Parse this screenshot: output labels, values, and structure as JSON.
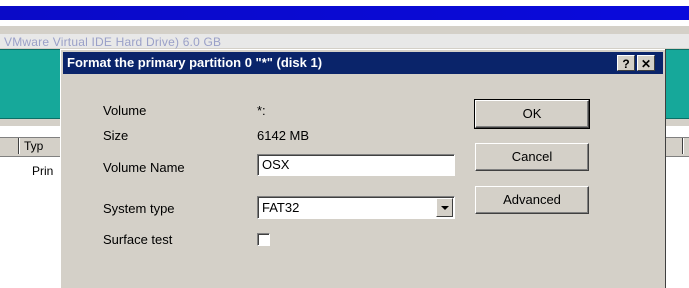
{
  "background": {
    "window_title": "VMware Virtual IDE Hard Drive) 6.0 GB",
    "column_header": "Typ",
    "row_text": "Prin"
  },
  "dialog": {
    "title": "Format the primary partition 0  \"*\" (disk 1)",
    "help_label": "?",
    "close_label": "✕",
    "fields": {
      "volume_label": "Volume",
      "volume_value": "*:",
      "size_label": "Size",
      "size_value": "6142 MB",
      "volume_name_label": "Volume Name",
      "volume_name_value": "OSX",
      "system_type_label": "System type",
      "system_type_value": "FAT32",
      "surface_test_label": "Surface test"
    },
    "buttons": {
      "ok": "OK",
      "cancel": "Cancel",
      "advanced": "Advanced"
    }
  },
  "colors": {
    "title_bar": "#0a246a",
    "dialog_face": "#d4d0c8",
    "teal_panel": "#16a89a"
  }
}
